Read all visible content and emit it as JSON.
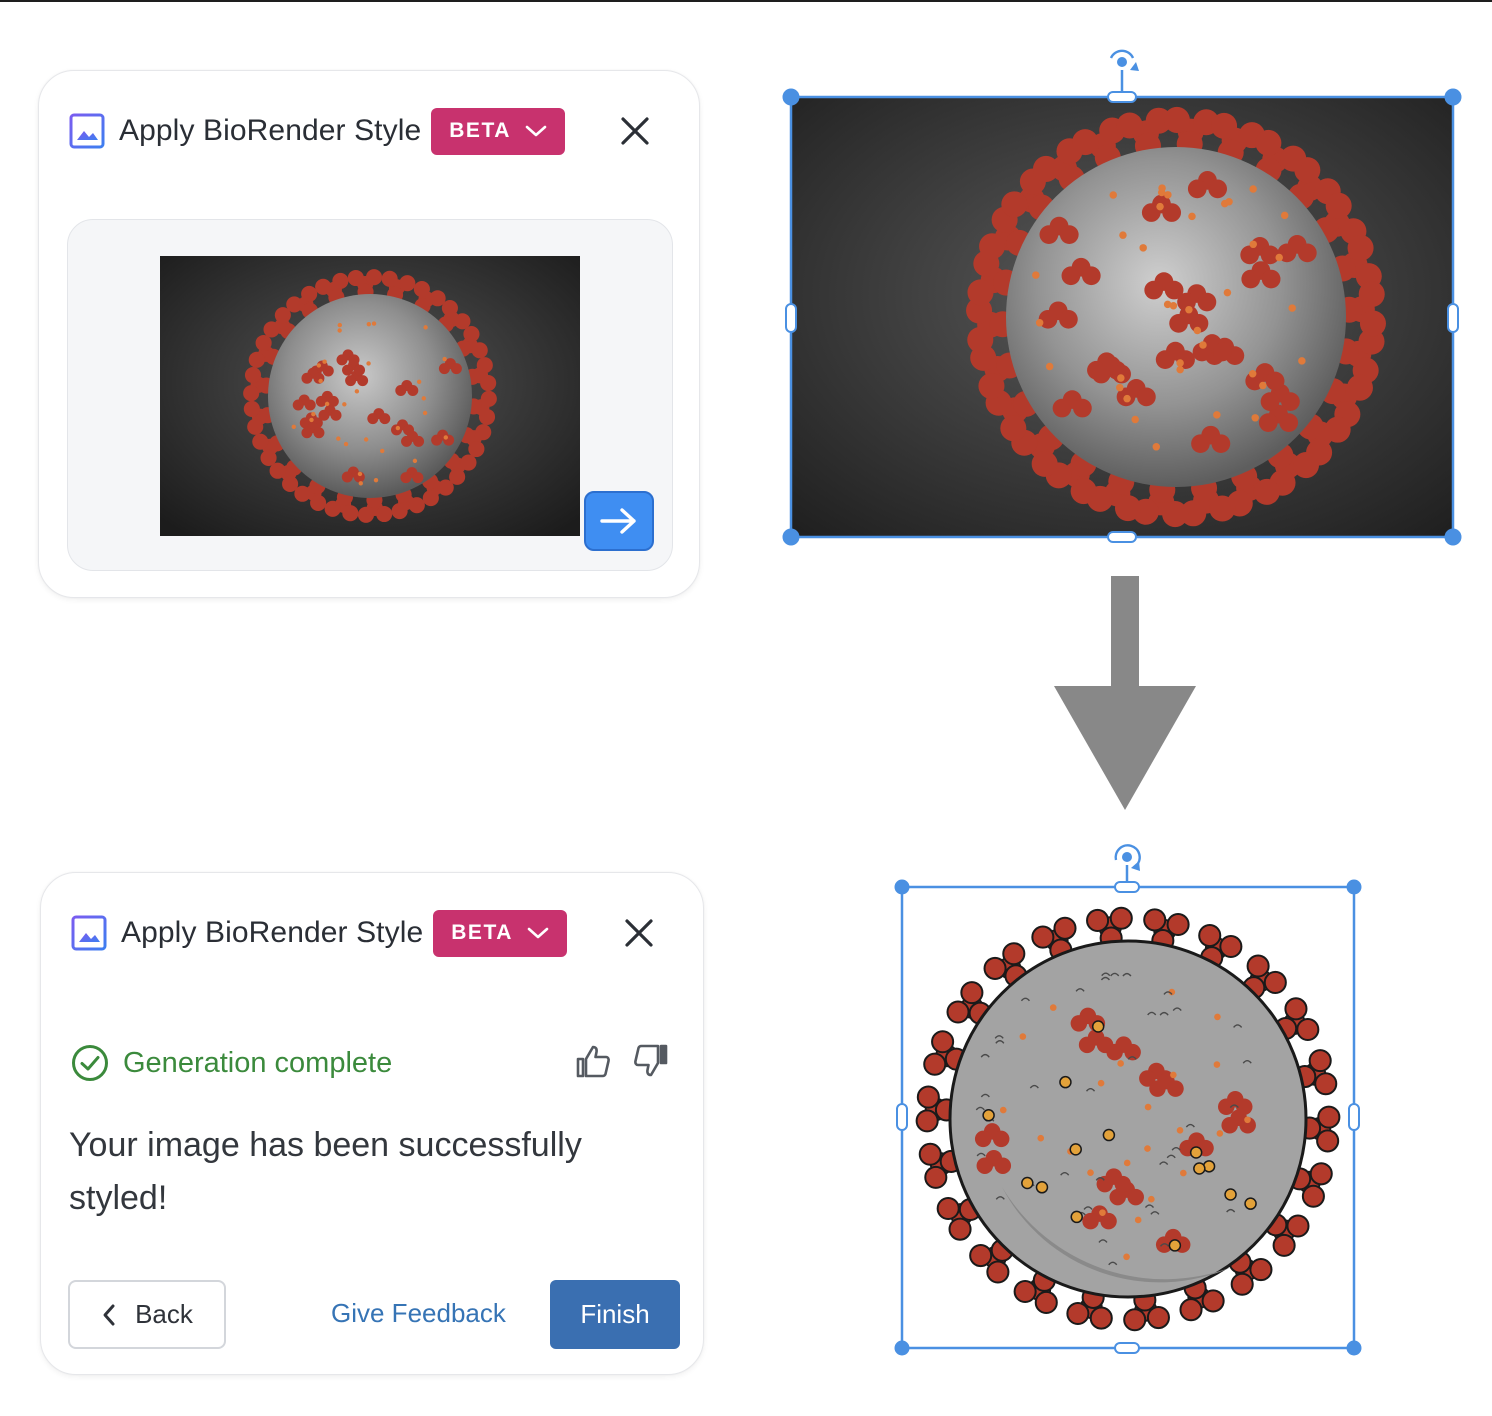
{
  "dialog_before": {
    "title": "Apply BioRender Style",
    "badge": "BETA"
  },
  "dialog_after": {
    "title": "Apply BioRender Style",
    "badge": "BETA",
    "status": "Generation complete",
    "message": "Your image has been successfully styled!",
    "back_label": "Back",
    "feedback_label": "Give Feedback",
    "finish_label": "Finish"
  },
  "icons": {
    "image": "image-icon",
    "chevron": "chevron-down-icon",
    "close": "close-icon",
    "submit": "arrow-right-icon",
    "status": "check-circle-icon",
    "like": "thumbs-up-icon",
    "dislike": "thumbs-down-icon",
    "back": "chevron-left-icon",
    "rotate": "rotate-handle-icon",
    "flow": "arrow-down-icon"
  },
  "colors": {
    "badge": "#c8326e",
    "primary": "#3a6fb1",
    "submit": "#3f8ef2",
    "success": "#3b8a3c",
    "link": "#3674b5",
    "selection": "#4a90e2",
    "virus_spike": "#b33a2b",
    "virus_body": "#9a9a9a",
    "arrow": "#888888"
  }
}
